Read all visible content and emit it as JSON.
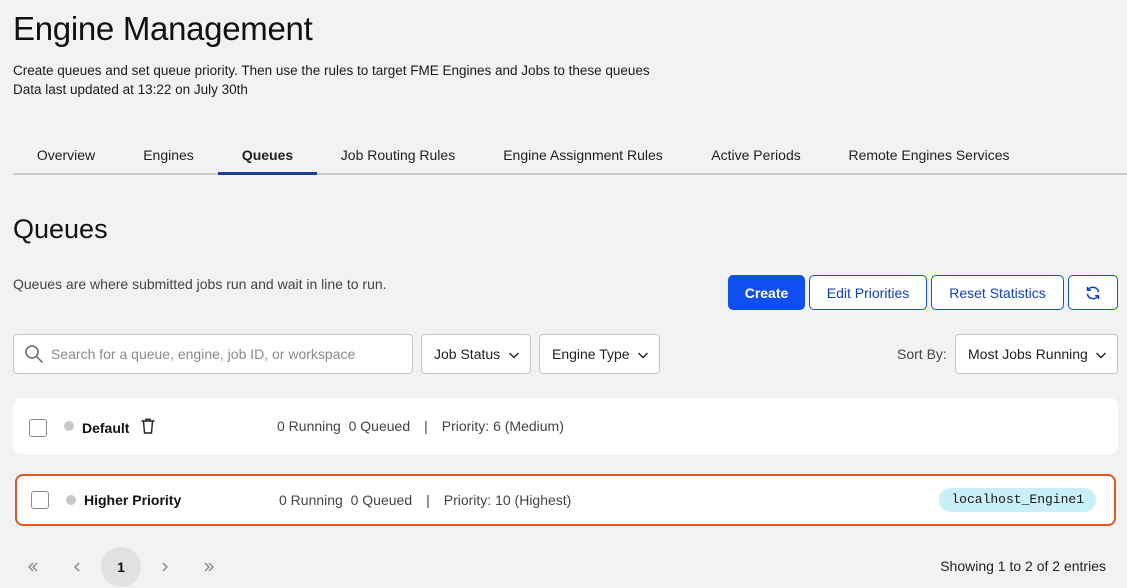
{
  "header": {
    "title": "Engine Management",
    "description": "Create queues and set queue priority. Then use the rules to target FME Engines and Jobs to these queues",
    "last_updated": "Data last updated at 13:22 on July 30th"
  },
  "tabs": [
    {
      "label": "Overview",
      "active": false
    },
    {
      "label": "Engines",
      "active": false
    },
    {
      "label": "Queues",
      "active": true
    },
    {
      "label": "Job Routing Rules",
      "active": false
    },
    {
      "label": "Engine Assignment Rules",
      "active": false
    },
    {
      "label": "Active Periods",
      "active": false
    },
    {
      "label": "Remote Engines Services",
      "active": false
    }
  ],
  "section": {
    "title": "Queues",
    "description": "Queues are where submitted jobs run and wait in line to run."
  },
  "actions": {
    "create": "Create",
    "edit_priorities": "Edit Priorities",
    "reset_statistics": "Reset Statistics",
    "refresh_icon": "refresh-icon"
  },
  "filters": {
    "search_placeholder": "Search for a queue, engine, job ID, or workspace",
    "search_value": "",
    "job_status": "Job Status",
    "engine_type": "Engine Type",
    "sort_by_label": "Sort By:",
    "sort_by_value": "Most Jobs Running"
  },
  "queues": [
    {
      "name": "Default",
      "running": "0 Running",
      "queued": "0 Queued",
      "separator": "|",
      "priority": "Priority: 6 (Medium)",
      "engine": "",
      "checked": false
    },
    {
      "name": "Higher Priority",
      "running": "0 Running",
      "queued": "0 Queued",
      "separator": "|",
      "priority": "Priority: 10 (Highest)",
      "engine": "localhost_Engine1",
      "checked": false
    }
  ],
  "pagination": {
    "current_page": "1",
    "entries_text": "Showing 1 to 2 of 2 entries"
  },
  "colors": {
    "primary": "#0f4ef0",
    "active_tab": "#1c3f95",
    "highlight_border": "#e2571d",
    "engine_tag": "#c9f0f6"
  }
}
